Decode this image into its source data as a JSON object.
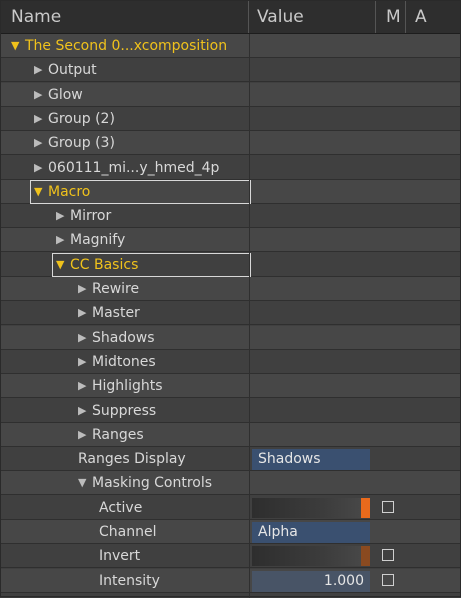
{
  "header": {
    "name": "Name",
    "value": "Value",
    "m": "M",
    "a": "A"
  },
  "rows": [
    {
      "label": "The Second 0...xcomposition",
      "arrow": "▼",
      "indent": 10,
      "yellow": true
    },
    {
      "label": "Output",
      "arrow": "▶",
      "indent": 33
    },
    {
      "label": "Glow",
      "arrow": "▶",
      "indent": 33
    },
    {
      "label": "Group (2)",
      "arrow": "▶",
      "indent": 33
    },
    {
      "label": "Group (3)",
      "arrow": "▶",
      "indent": 33
    },
    {
      "label": "060111_mi...y_hmed_4p",
      "arrow": "▶",
      "indent": 33
    },
    {
      "label": "Macro",
      "arrow": "▼",
      "indent": 33,
      "yellow": true,
      "selected": true
    },
    {
      "label": "Mirror",
      "arrow": "▶",
      "indent": 55
    },
    {
      "label": "Magnify",
      "arrow": "▶",
      "indent": 55
    },
    {
      "label": "CC Basics",
      "arrow": "▼",
      "indent": 55,
      "yellow": true,
      "selected": true
    },
    {
      "label": "Rewire",
      "arrow": "▶",
      "indent": 77
    },
    {
      "label": "Master",
      "arrow": "▶",
      "indent": 77
    },
    {
      "label": "Shadows",
      "arrow": "▶",
      "indent": 77
    },
    {
      "label": "Midtones",
      "arrow": "▶",
      "indent": 77
    },
    {
      "label": "Highlights",
      "arrow": "▶",
      "indent": 77
    },
    {
      "label": "Suppress",
      "arrow": "▶",
      "indent": 77
    },
    {
      "label": "Ranges",
      "arrow": "▶",
      "indent": 77
    },
    {
      "label": "Ranges Display",
      "arrow": "",
      "indent": 77,
      "value": "Shadows",
      "value_type": "dropdown"
    },
    {
      "label": "Masking Controls",
      "arrow": "▼",
      "indent": 77
    },
    {
      "label": "Active",
      "arrow": "",
      "indent": 98,
      "value_type": "slider",
      "level": 1.0,
      "checkbox": true
    },
    {
      "label": "Channel",
      "arrow": "",
      "indent": 98,
      "value": "Alpha",
      "value_type": "dropdown"
    },
    {
      "label": "Invert",
      "arrow": "",
      "indent": 98,
      "value_type": "slider-dim",
      "level": 1.0,
      "checkbox": true
    },
    {
      "label": "Intensity",
      "arrow": "",
      "indent": 98,
      "value": "1.000",
      "value_type": "number",
      "checkbox": true
    }
  ],
  "colors": {
    "accent_yellow": "#f0c21c",
    "slider_orange": "#e96a1c",
    "field_blue": "#3a5070"
  }
}
